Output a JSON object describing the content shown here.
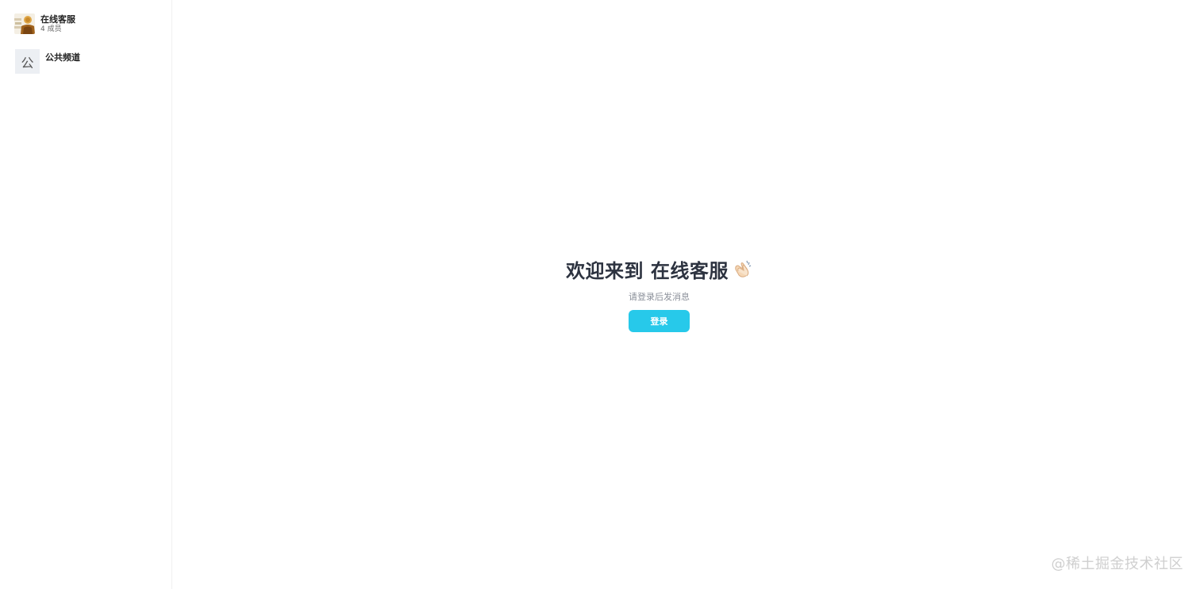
{
  "sidebar": {
    "group": {
      "name": "在线客服",
      "members": "4 成员",
      "avatar_icon": "group-photo-avatar"
    },
    "channels": [
      {
        "avatar_char": "公",
        "name": "公共频道"
      }
    ]
  },
  "main": {
    "title": "欢迎来到 在线客服",
    "title_icon": "clapping-hands-icon",
    "subtitle": "请登录后发消息",
    "login_label": "登录"
  },
  "watermark": "@稀土掘金技术社区",
  "colors": {
    "accent": "#27c9ea",
    "title": "#2d3340",
    "subtitle": "#8a8f99",
    "channel_avatar_bg": "#eceff3"
  }
}
